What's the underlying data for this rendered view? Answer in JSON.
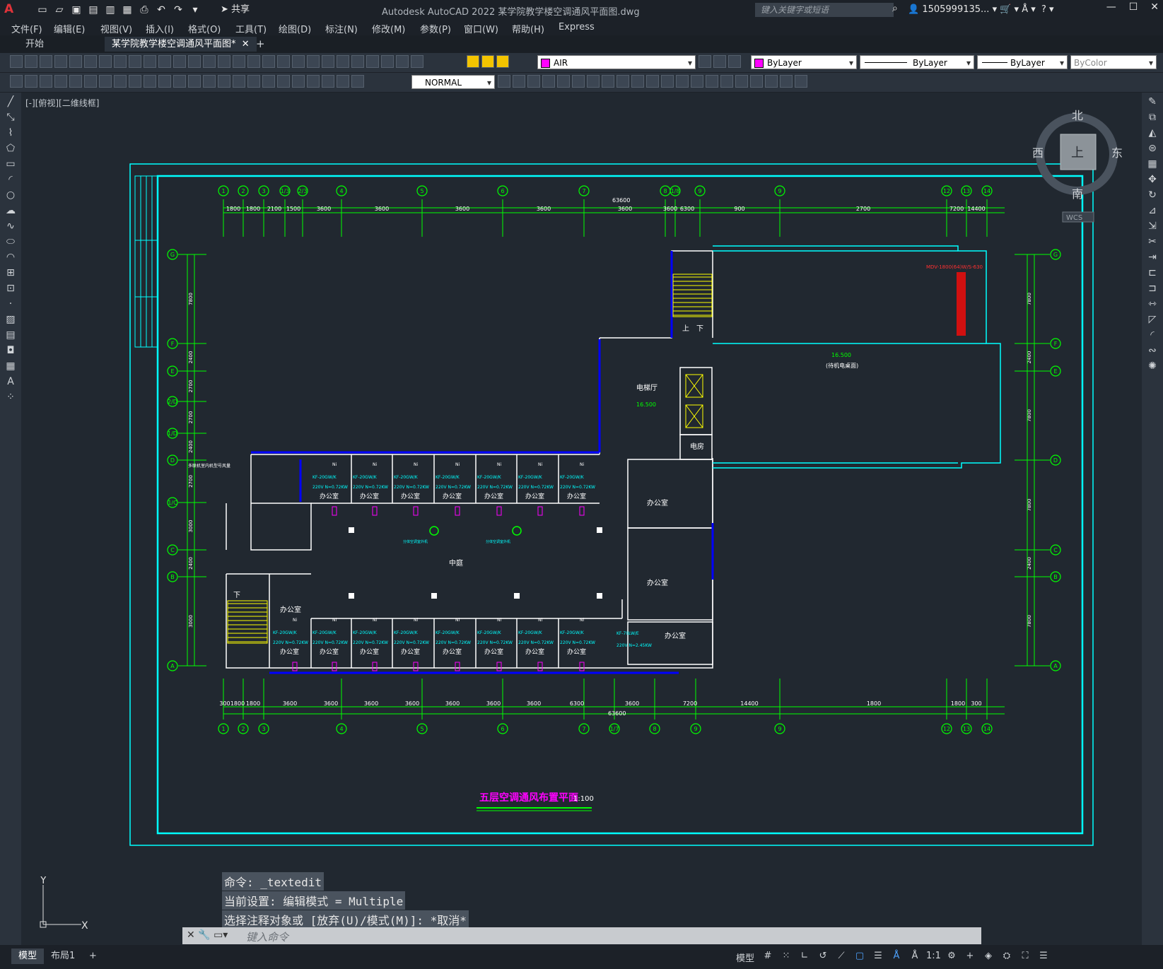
{
  "app": {
    "logo": "A",
    "title": "Autodesk AutoCAD 2022    某学院教学楼空调通风平面图.dwg",
    "share": "共享",
    "search_placeholder": "键入关键字或短语",
    "user": "1505999135...",
    "win_buttons": [
      "—",
      "☐",
      "✕"
    ]
  },
  "menu": [
    "文件(F)",
    "编辑(E)",
    "视图(V)",
    "插入(I)",
    "格式(O)",
    "工具(T)",
    "绘图(D)",
    "标注(N)",
    "修改(M)",
    "参数(P)",
    "窗口(W)",
    "帮助(H)",
    "Express"
  ],
  "tabs": {
    "start": "开始",
    "active": "某学院教学楼空调通风平面图*",
    "close": "✕",
    "plus": "+"
  },
  "toolbar": {
    "layer": "AIR",
    "color": "ByLayer",
    "linetype": "ByLayer",
    "lineweight": "ByLayer",
    "plotstyle": "ByColor",
    "textstyle": "NORMAL"
  },
  "viewport_label": "[-][俯视][二维线框]",
  "viewcube": {
    "north": "北",
    "south": "南",
    "east": "东",
    "west": "西",
    "top": "上",
    "wcs": "WCS"
  },
  "drawing": {
    "title": "五层空调通风布置平面",
    "scale": "1:100",
    "top_axes": [
      "1",
      "2",
      "3",
      "1/3",
      "2/3",
      "4",
      "5",
      "6",
      "7",
      "8",
      "1/8",
      "9",
      "9",
      "12",
      "13",
      "14"
    ],
    "bottom_axes": [
      "1",
      "2",
      "3",
      "4",
      "5",
      "6",
      "7",
      "1/7",
      "8",
      "9",
      "9",
      "12",
      "13",
      "14"
    ],
    "left_axes": [
      "G",
      "F",
      "E",
      "2/D",
      "1/D",
      "D",
      "1/C",
      "C",
      "B",
      "A"
    ],
    "right_axes": [
      "G",
      "F",
      "E",
      "D",
      "C",
      "B",
      "A"
    ],
    "top_dims": [
      "1800",
      "1800",
      "2100",
      "1500",
      "3600",
      "3600",
      "3600",
      "3600",
      "3600",
      "3600",
      "6300",
      "900",
      "2700",
      "7200",
      "14400",
      "1800",
      "1800"
    ],
    "bottom_dims": [
      "300",
      "1800",
      "1800",
      "3600",
      "3600",
      "3600",
      "3600",
      "3600",
      "3600",
      "3600",
      "6300",
      "3600",
      "7200",
      "14400",
      "1800",
      "1800",
      "300"
    ],
    "total_dim": "63600",
    "left_dims": [
      "7800",
      "2400",
      "2700",
      "2700",
      "2400",
      "2700",
      "3000",
      "2400",
      "3000",
      "4500"
    ],
    "right_dims": [
      "7800",
      "2400",
      "7800",
      "7800",
      "2400",
      "7800",
      "36300"
    ],
    "rooms": {
      "office": "办公室",
      "elevator_hall": "电梯厅",
      "courtyard": "中庭",
      "electrical": "电房",
      "up": "上",
      "down": "下",
      "stair_down": "下"
    },
    "elev_1": "16.500",
    "elev_2": "16.500",
    "big_room": "(待机电桌面)",
    "unit_note": "KF-20GW/K",
    "power_note": "220V N=0.72KW",
    "vrv_note": "MDV-1800(64)W/S-630",
    "left_note": "多联机室内机型号风量",
    "ac_note_1": "分体空调室外机",
    "ac_note_2": "分体空调室外机",
    "right_office_unit": "KF-70LW/E",
    "right_office_power": "220V N=2.45KW",
    "wh_label": "Wi",
    "ni_label": "Ni"
  },
  "command": {
    "line1": "命令: _textedit",
    "line2": "当前设置: 编辑模式 = Multiple",
    "line3": "选择注释对象或 [放弃(U)/模式(M)]: *取消*",
    "placeholder": "键入命令"
  },
  "status": {
    "model_tab": "模型",
    "layout_tab": "布局1",
    "plus": "+",
    "model_btn": "模型",
    "scale": "1:1"
  },
  "colors": {
    "cyan": "#00ffff",
    "green": "#00ff00",
    "blue": "#0000ff",
    "magenta": "#ff00ff",
    "yellow": "#ffff00",
    "red": "#ff0000",
    "bg": "#212830"
  }
}
